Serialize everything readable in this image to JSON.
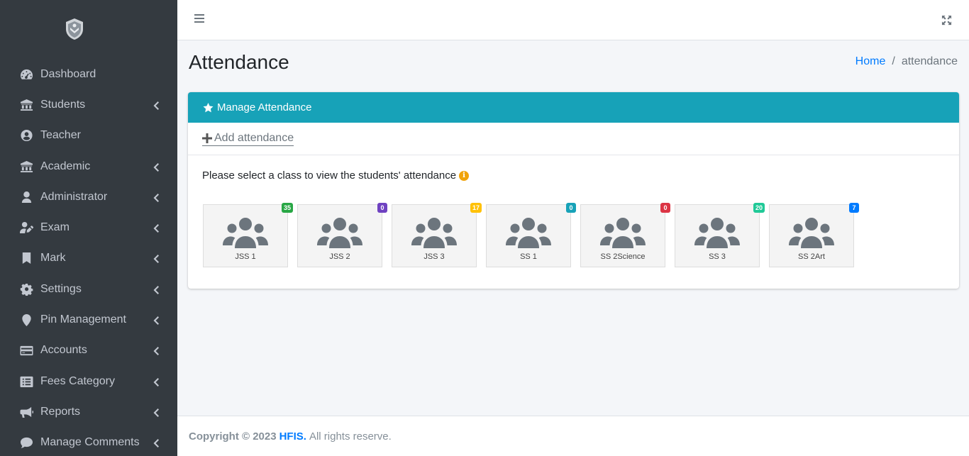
{
  "sidebar": {
    "items": [
      {
        "label": "Dashboard",
        "icon": "tachometer-icon",
        "has_children": false
      },
      {
        "label": "Students",
        "icon": "university-icon",
        "has_children": true
      },
      {
        "label": "Teacher",
        "icon": "user-circle-icon",
        "has_children": false
      },
      {
        "label": "Academic",
        "icon": "university-icon",
        "has_children": true
      },
      {
        "label": "Administrator",
        "icon": "user-icon",
        "has_children": true
      },
      {
        "label": "Exam",
        "icon": "user-edit-icon",
        "has_children": true
      },
      {
        "label": "Mark",
        "icon": "bookmark-icon",
        "has_children": true
      },
      {
        "label": "Settings",
        "icon": "gear-icon",
        "has_children": true
      },
      {
        "label": "Pin Management",
        "icon": "map-marker-icon",
        "has_children": true
      },
      {
        "label": "Accounts",
        "icon": "credit-card-icon",
        "has_children": true
      },
      {
        "label": "Fees Category",
        "icon": "list-alt-icon",
        "has_children": true
      },
      {
        "label": "Reports",
        "icon": "bullhorn-icon",
        "has_children": true
      },
      {
        "label": "Manage Comments",
        "icon": "comment-icon",
        "has_children": true
      }
    ]
  },
  "header": {
    "title": "Attendance",
    "breadcrumb_home": "Home",
    "breadcrumb_separator": "/",
    "breadcrumb_current": "attendance"
  },
  "card": {
    "title": "Manage Attendance",
    "add_link": "Add attendance",
    "select_message": "Please select a class to view the students' attendance",
    "info_glyph": "i"
  },
  "classes": [
    {
      "name": "JSS 1",
      "count": "35",
      "badge_color": "#28a745"
    },
    {
      "name": "JSS 2",
      "count": "0",
      "badge_color": "#6f42c1"
    },
    {
      "name": "JSS 3",
      "count": "17",
      "badge_color": "#ffc107"
    },
    {
      "name": "SS 1",
      "count": "0",
      "badge_color": "#17a2b8"
    },
    {
      "name": "SS 2Science",
      "count": "0",
      "badge_color": "#dc3545"
    },
    {
      "name": "SS 3",
      "count": "20",
      "badge_color": "#20c997"
    },
    {
      "name": "SS 2Art",
      "count": "7",
      "badge_color": "#007bff"
    }
  ],
  "footer": {
    "copyright": "Copyright © 2023",
    "brand": "HFIS.",
    "rest": "All rights reserve."
  },
  "colors": {
    "sidebar_bg": "#343a40",
    "card_header": "#17a2b8",
    "link": "#007bff"
  }
}
